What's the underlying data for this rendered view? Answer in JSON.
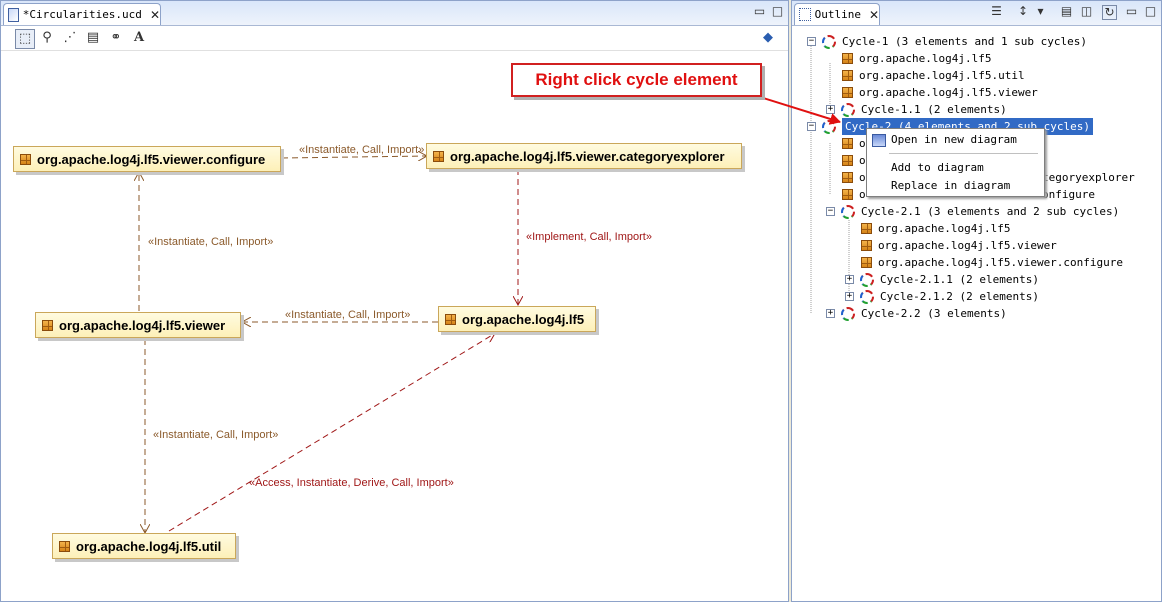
{
  "editor": {
    "tab_title": "*Circularities.ucd",
    "tab_icon": "diagram-icon",
    "toolbar": [
      "select-icon",
      "zoom-icon",
      "dependency-icon",
      "note-icon",
      "link-icon",
      "text-icon"
    ],
    "nodes": {
      "configure": "org.apache.log4j.lf5.viewer.configure",
      "categoryexplorer": "org.apache.log4j.lf5.viewer.categoryexplorer",
      "viewer": "org.apache.log4j.lf5.viewer",
      "lf5": "org.apache.log4j.lf5",
      "util": "org.apache.log4j.lf5.util"
    },
    "edges": {
      "configure_to_categoryexplorer": "«Instantiate, Call, Import»",
      "viewer_to_configure": "«Instantiate, Call, Import»",
      "categoryexplorer_to_lf5": "«Implement, Call, Import»",
      "lf5_to_viewer": "«Instantiate, Call, Import»",
      "viewer_to_util": "«Instantiate, Call, Import»",
      "util_to_lf5": "«Access, Instantiate, Derive, Call, Import»"
    },
    "edge_colors": {
      "brown": "#8b5a2b",
      "red": "#a01818"
    }
  },
  "callout": {
    "text": "Right click cycle element",
    "color": "#e01010"
  },
  "outline": {
    "tab_title": "Outline",
    "tree": {
      "cycle1": "Cycle-1  (3 elements and 1 sub cycles)",
      "c1_a": "org.apache.log4j.lf5",
      "c1_b": "org.apache.log4j.lf5.util",
      "c1_c": "org.apache.log4j.lf5.viewer",
      "cycle11": "Cycle-1.1  (2 elements)",
      "cycle2": "Cycle-2  (4 elements and 2 sub cycles)",
      "c2_a_part": "o",
      "c2_b_part": "o",
      "c2_c_part": "tegoryexplorer",
      "c2_d_part": "onfigure",
      "c2_c_prefix": "o",
      "c2_d_prefix": "o",
      "cycle21": "Cycle-2.1  (3 elements and 2 sub cycles)",
      "c21_a": "org.apache.log4j.lf5",
      "c21_b": "org.apache.log4j.lf5.viewer",
      "c21_c": "org.apache.log4j.lf5.viewer.configure",
      "cycle211": "Cycle-2.1.1  (2 elements)",
      "cycle212": "Cycle-2.1.2  (2 elements)",
      "cycle22": "Cycle-2.2  (3 elements)"
    }
  },
  "context_menu": {
    "open": "Open in new diagram",
    "add": "Add to diagram",
    "replace": "Replace in diagram"
  },
  "colors": {
    "selection": "#316ac5",
    "node_border": "#caa75a",
    "node_fill": "#fdf0b8"
  }
}
